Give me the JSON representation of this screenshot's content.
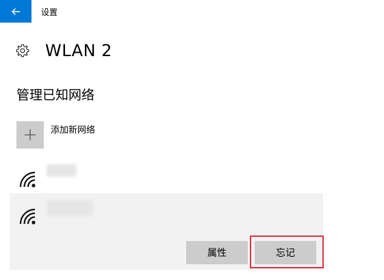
{
  "window": {
    "title": "设置"
  },
  "header": {
    "title": "WLAN 2",
    "icon": "gear-icon"
  },
  "section": {
    "title": "管理已知网络"
  },
  "add_network": {
    "label": "添加新网络",
    "icon": "plus-icon"
  },
  "networks": [
    {
      "name": "",
      "icon": "wifi-signal-icon",
      "selected": false
    },
    {
      "name": "",
      "icon": "wifi-signal-icon",
      "selected": true
    }
  ],
  "actions": {
    "properties_label": "属性",
    "forget_label": "忘记"
  },
  "colors": {
    "accent": "#0078d7",
    "highlight": "#d9363e",
    "button_bg": "#cccccc",
    "selected_bg": "#f2f2f2"
  }
}
